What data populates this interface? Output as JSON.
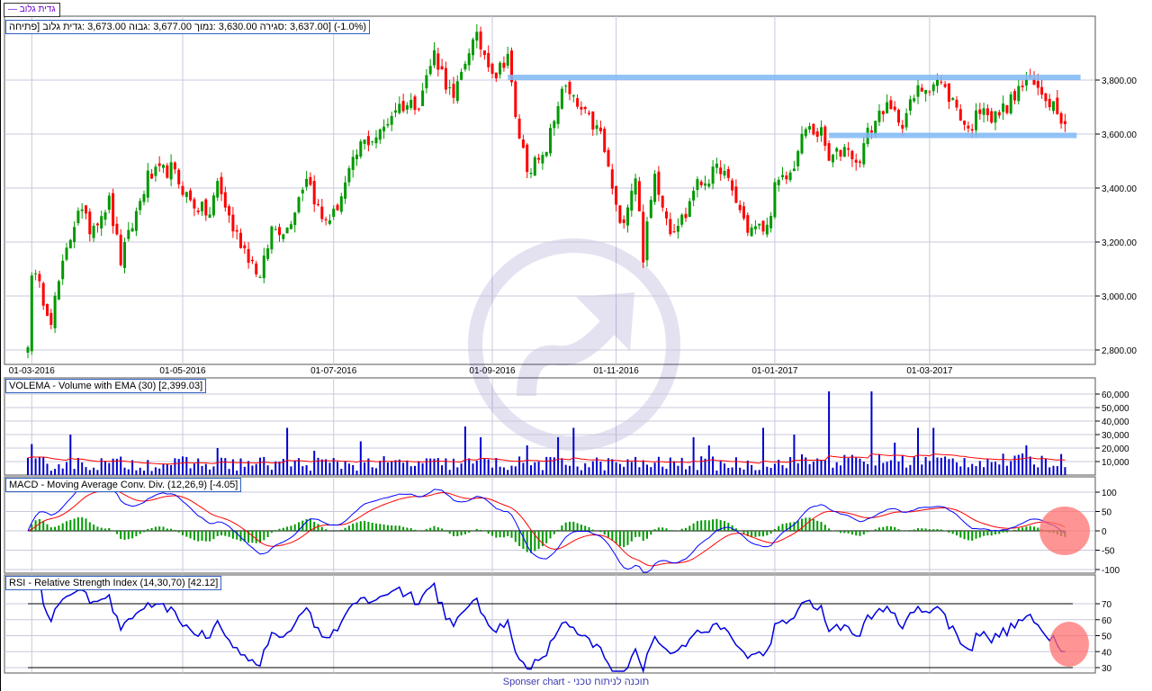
{
  "legend": {
    "label": "גדית גלוב",
    "color": "#6a00d0"
  },
  "header": {
    "info": "(1.0%-) [3,637.00 :סגירה 3,630.00 :נמוך 3,677.00 :גבוה 3,673.00 :גדית גלוב [פתיחה"
  },
  "footer": {
    "text": "Sponser chart - תוכנה לניתוח טכני"
  },
  "colors": {
    "up": "#009900",
    "down": "#ff0000",
    "volume": "#0000cc",
    "ema": "#ff0000",
    "macd": "#0000ff",
    "signal": "#ff0000",
    "hist": "#009900",
    "rsi": "#0000dd",
    "support": "#7fb8f5",
    "highlight": "#ff7070"
  },
  "chart_data": [
    {
      "type": "candlestick",
      "title": "גדית גלוב",
      "candles_count": 269,
      "x_ticks": [
        {
          "idx": 1,
          "label": "01-03-2016"
        },
        {
          "idx": 40,
          "label": "01-05-2016"
        },
        {
          "idx": 79,
          "label": "01-07-2016"
        },
        {
          "idx": 120,
          "label": "01-09-2016"
        },
        {
          "idx": 152,
          "label": "01-11-2016"
        },
        {
          "idx": 193,
          "label": "01-01-2017"
        },
        {
          "idx": 233,
          "label": "01-03-2017"
        }
      ],
      "y_ticks": [
        2800,
        3000,
        3200,
        3400,
        3600,
        3800
      ],
      "y_tick_labels": [
        "2,800.00",
        "3,000.00",
        "3,200.00",
        "3,400.00",
        "3,600.00",
        "3,800.00"
      ],
      "ylim": [
        2770,
        4030
      ],
      "price_anchors": [
        [
          0,
          2810
        ],
        [
          1,
          3100
        ],
        [
          6,
          2920
        ],
        [
          8,
          3050
        ],
        [
          13,
          3330
        ],
        [
          16,
          3250
        ],
        [
          21,
          3350
        ],
        [
          24,
          3130
        ],
        [
          31,
          3440
        ],
        [
          37,
          3470
        ],
        [
          42,
          3350
        ],
        [
          47,
          3300
        ],
        [
          49,
          3420
        ],
        [
          53,
          3250
        ],
        [
          59,
          3100
        ],
        [
          60,
          3060
        ],
        [
          63,
          3250
        ],
        [
          67,
          3250
        ],
        [
          72,
          3450
        ],
        [
          76,
          3280
        ],
        [
          79,
          3300
        ],
        [
          83,
          3450
        ],
        [
          86,
          3560
        ],
        [
          91,
          3600
        ],
        [
          95,
          3700
        ],
        [
          101,
          3720
        ],
        [
          105,
          3900
        ],
        [
          110,
          3720
        ],
        [
          114,
          3920
        ],
        [
          116,
          3950
        ],
        [
          121,
          3820
        ],
        [
          124,
          3900
        ],
        [
          126,
          3650
        ],
        [
          129,
          3480
        ],
        [
          133,
          3500
        ],
        [
          136,
          3650
        ],
        [
          138,
          3780
        ],
        [
          142,
          3700
        ],
        [
          148,
          3600
        ],
        [
          151,
          3400
        ],
        [
          153,
          3250
        ],
        [
          157,
          3450
        ],
        [
          159,
          3150
        ],
        [
          162,
          3450
        ],
        [
          166,
          3250
        ],
        [
          170,
          3300
        ],
        [
          172,
          3400
        ],
        [
          177,
          3450
        ],
        [
          179,
          3480
        ],
        [
          183,
          3350
        ],
        [
          186,
          3250
        ],
        [
          191,
          3250
        ],
        [
          193,
          3400
        ],
        [
          197,
          3450
        ],
        [
          201,
          3620
        ],
        [
          205,
          3600
        ],
        [
          207,
          3500
        ],
        [
          212,
          3560
        ],
        [
          214,
          3480
        ],
        [
          217,
          3600
        ],
        [
          221,
          3700
        ],
        [
          226,
          3650
        ],
        [
          230,
          3760
        ],
        [
          235,
          3800
        ],
        [
          240,
          3700
        ],
        [
          243,
          3610
        ],
        [
          247,
          3720
        ],
        [
          249,
          3650
        ],
        [
          254,
          3720
        ],
        [
          258,
          3800
        ],
        [
          263,
          3740
        ],
        [
          266,
          3700
        ],
        [
          268,
          3637
        ]
      ],
      "support_lines": [
        {
          "price": 3810,
          "from_idx": 124,
          "to_idx": 272
        },
        {
          "price": 3595,
          "from_idx": 207,
          "to_idx": 271
        }
      ]
    },
    {
      "type": "bar",
      "title": "VOLEMA - Volume with EMA (30) [2,399.03]",
      "y_ticks": [
        10000,
        20000,
        30000,
        40000,
        50000,
        60000
      ],
      "y_tick_labels": [
        "10,000",
        "20,000",
        "30,000",
        "40,000",
        "50,000",
        "60,000"
      ],
      "ylim": [
        0,
        70000
      ],
      "ema_period": 30,
      "spikes": [
        [
          1,
          23000
        ],
        [
          11,
          30000
        ],
        [
          49,
          20000
        ],
        [
          67,
          35000
        ],
        [
          74,
          18000
        ],
        [
          86,
          25000
        ],
        [
          113,
          36000
        ],
        [
          117,
          28000
        ],
        [
          129,
          22000
        ],
        [
          137,
          28000
        ],
        [
          141,
          35000
        ],
        [
          172,
          28000
        ],
        [
          176,
          22000
        ],
        [
          190,
          35000
        ],
        [
          198,
          30000
        ],
        [
          207,
          62000
        ],
        [
          218,
          62000
        ],
        [
          224,
          24000
        ],
        [
          230,
          35000
        ],
        [
          234,
          35000
        ],
        [
          258,
          22000
        ]
      ]
    },
    {
      "type": "line",
      "title": "MACD - Moving Average Conv. Div. (12,26,9) [-4.05]",
      "params": [
        12,
        26,
        9
      ],
      "y_ticks": [
        -100,
        -50,
        0,
        50,
        100
      ],
      "y_tick_labels": [
        "-100",
        "-50",
        "0",
        "50",
        "100"
      ],
      "ylim": [
        -110,
        110
      ]
    },
    {
      "type": "line",
      "title": "RSI - Relative Strength Index (14,30,70) [42.12]",
      "period": 14,
      "levels": [
        30,
        70
      ],
      "y_ticks": [
        30,
        40,
        50,
        60,
        70
      ],
      "y_tick_labels": [
        "30",
        "40",
        "50",
        "60",
        "70"
      ],
      "ylim": [
        25,
        85
      ]
    }
  ]
}
